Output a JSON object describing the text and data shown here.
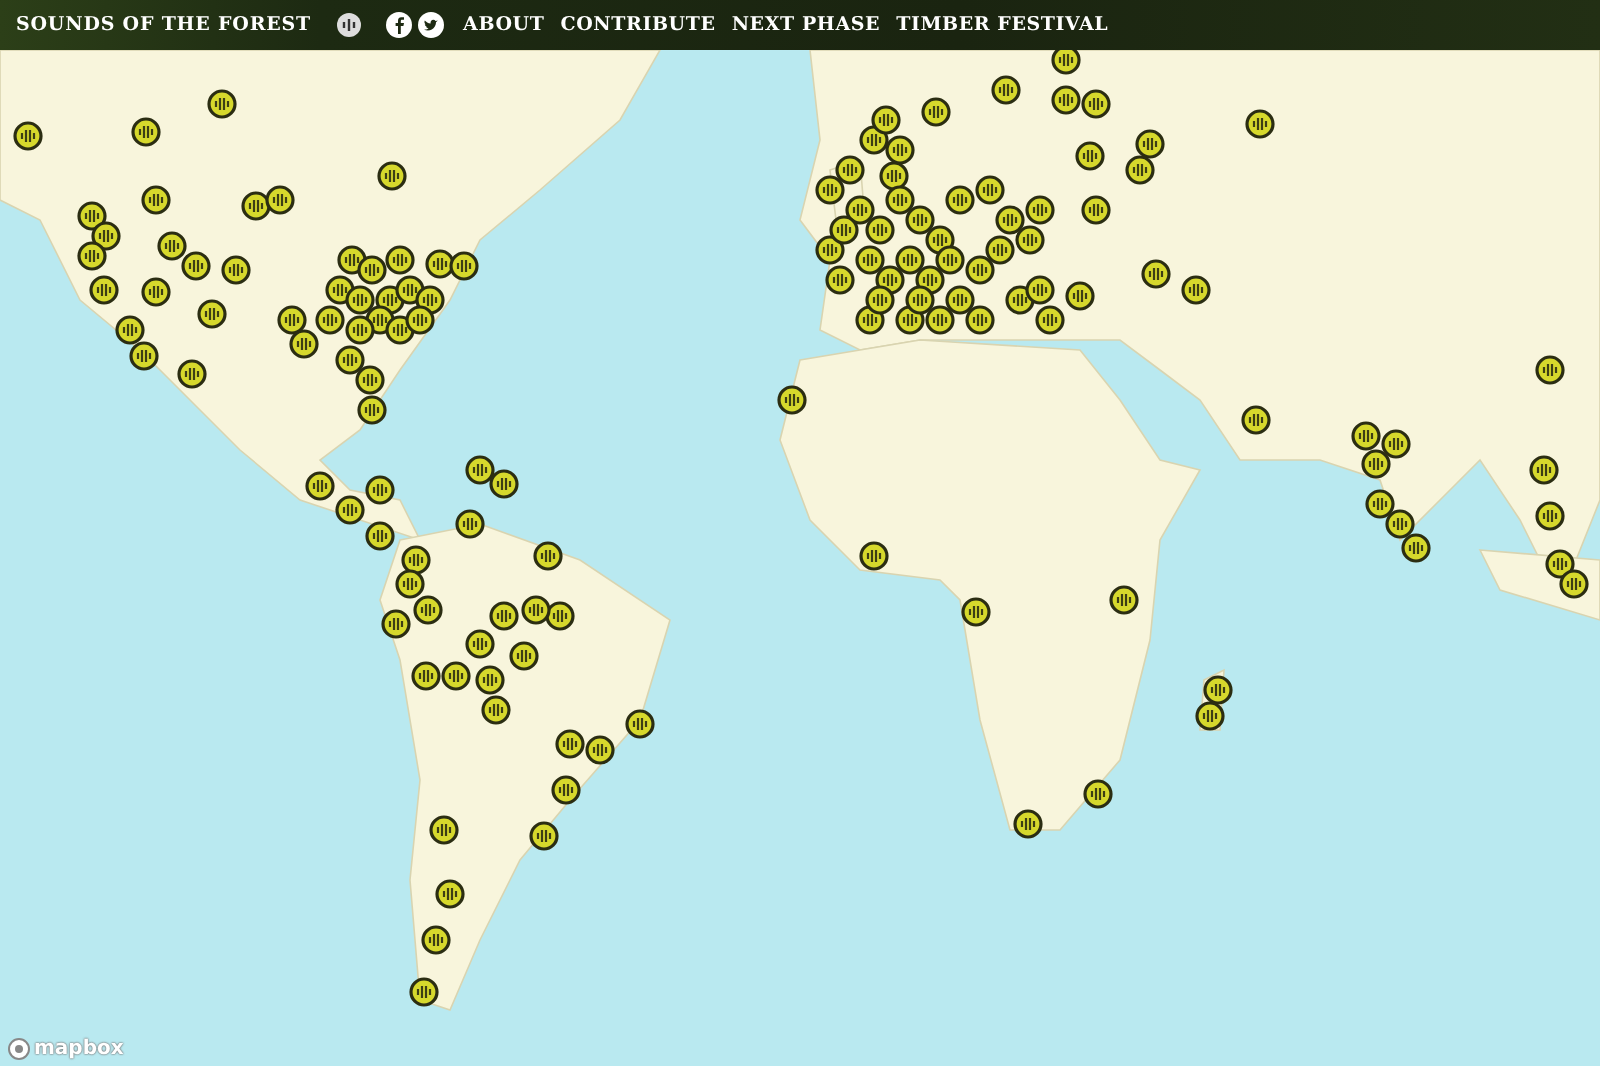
{
  "header": {
    "title": "SOUNDS OF THE FOREST",
    "nav": [
      "ABOUT",
      "CONTRIBUTE",
      "NEXT PHASE",
      "TIMBER FESTIVAL"
    ]
  },
  "map": {
    "attribution": "mapbox"
  }
}
